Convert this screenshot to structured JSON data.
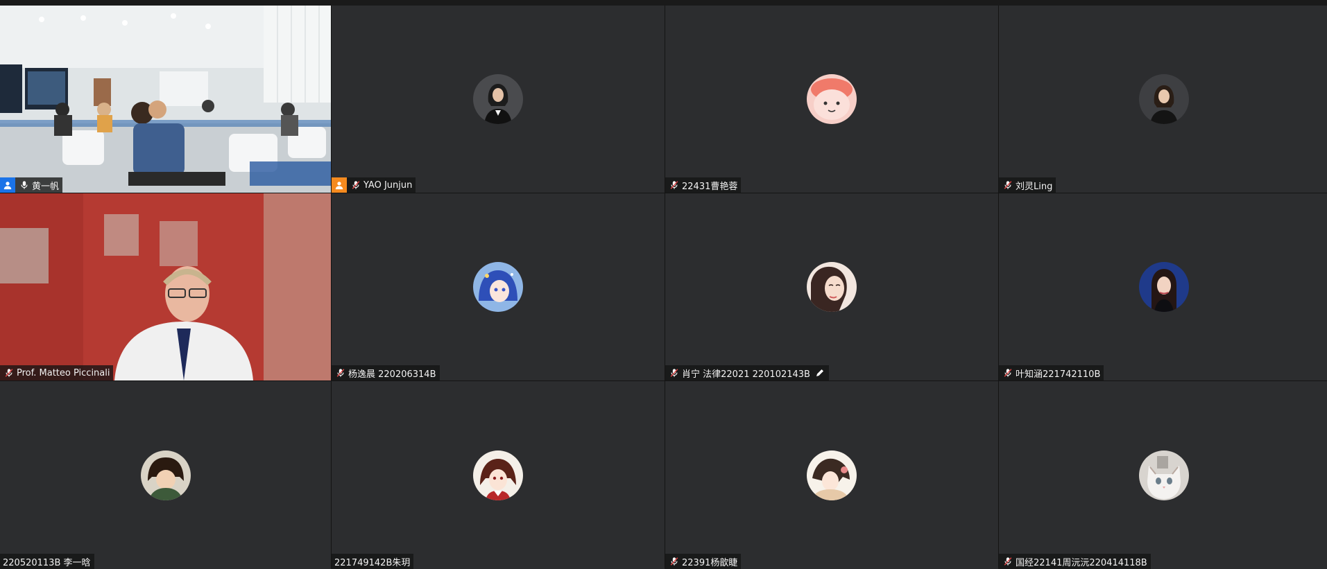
{
  "meeting": {
    "colors": {
      "tile_bg": "#2c2d2f",
      "active_speaker_border": "#2fb37f",
      "host_blue": "#1a73e8",
      "cohost_orange": "#f58a1f"
    },
    "participants": [
      {
        "name": "黄一帆",
        "video": "classroom",
        "badge": "host-badge",
        "mic": "mic-on-icon",
        "active": true
      },
      {
        "name": "YAO Junjun",
        "video": "avatar",
        "avatar_icon": "woman-portrait-avatar",
        "badge": "cohost-badge",
        "mic": "mic-muted-icon"
      },
      {
        "name": "22431曹艳蓉",
        "video": "avatar",
        "avatar_icon": "pink-cartoon-avatar",
        "mic": "mic-muted-icon"
      },
      {
        "name": "刘灵Ling",
        "video": "avatar",
        "avatar_icon": "woman-dark-portrait-avatar",
        "mic": "mic-muted-icon"
      },
      {
        "name": "Prof. Matteo Piccinali",
        "video": "webcam",
        "mic": "mic-muted-icon"
      },
      {
        "name": "杨逸晨 220206314B",
        "video": "avatar",
        "avatar_icon": "anime-blue-hair-avatar",
        "mic": "mic-muted-icon"
      },
      {
        "name": "肖宁 法律22021 220102143B",
        "video": "avatar",
        "avatar_icon": "illustrated-woman-avatar",
        "mic": "mic-muted-icon",
        "renamed": true
      },
      {
        "name": "叶知涵221742110B",
        "video": "avatar",
        "avatar_icon": "woman-blue-background-avatar",
        "mic": "mic-muted-icon"
      },
      {
        "name": "220520113B 李一晗",
        "video": "avatar",
        "avatar_icon": "boy-with-hair-avatar",
        "mic": "none"
      },
      {
        "name": "221749142B朱玥",
        "video": "avatar",
        "avatar_icon": "anime-red-avatar",
        "mic": "none"
      },
      {
        "name": "22391杨歆睫",
        "video": "avatar",
        "avatar_icon": "anime-girl-avatar",
        "mic": "mic-muted-icon"
      },
      {
        "name": "国经22141周沅沅220414118B",
        "video": "avatar",
        "avatar_icon": "white-cat-avatar",
        "mic": "mic-muted-icon"
      }
    ]
  }
}
